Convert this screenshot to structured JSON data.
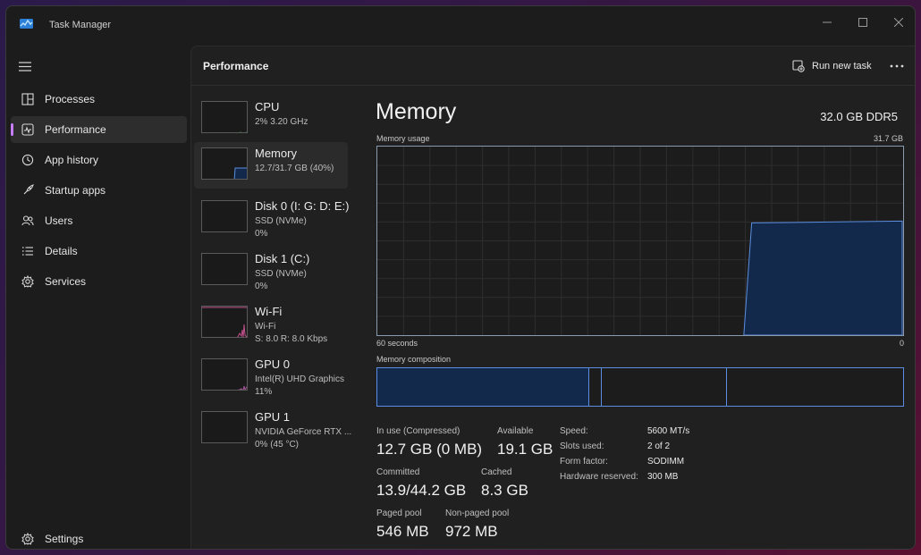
{
  "window": {
    "title": "Task Manager"
  },
  "nav": {
    "items": [
      {
        "label": "Processes",
        "icon": "processes-icon"
      },
      {
        "label": "Performance",
        "icon": "performance-icon",
        "active": true
      },
      {
        "label": "App history",
        "icon": "history-icon"
      },
      {
        "label": "Startup apps",
        "icon": "startup-icon"
      },
      {
        "label": "Users",
        "icon": "users-icon"
      },
      {
        "label": "Details",
        "icon": "details-icon"
      },
      {
        "label": "Services",
        "icon": "services-icon"
      }
    ],
    "settings_label": "Settings"
  },
  "header": {
    "title": "Performance",
    "run_new_task_label": "Run new task"
  },
  "devices": [
    {
      "name": "CPU",
      "line2": "2%  3.20 GHz",
      "line3": ""
    },
    {
      "name": "Memory",
      "line2": "12.7/31.7 GB (40%)",
      "line3": "",
      "active": true
    },
    {
      "name": "Disk 0 (I: G: D: E:)",
      "line2": "SSD (NVMe)",
      "line3": "0%"
    },
    {
      "name": "Disk 1 (C:)",
      "line2": "SSD (NVMe)",
      "line3": "0%"
    },
    {
      "name": "Wi-Fi",
      "line2": "Wi-Fi",
      "line3": "S: 8.0  R: 8.0 Kbps"
    },
    {
      "name": "GPU 0",
      "line2": "Intel(R) UHD Graphics",
      "line3": "11%"
    },
    {
      "name": "GPU 1",
      "line2": "NVIDIA GeForce RTX ...",
      "line3": "0%  (45 °C)"
    }
  ],
  "memory": {
    "title": "Memory",
    "capacity": "32.0 GB DDR5",
    "usage_label": "Memory usage",
    "usage_max": "31.7 GB",
    "time_span": "60 seconds",
    "time_end": "0",
    "composition_label": "Memory composition",
    "usage_fraction": 0.6,
    "stats": {
      "in_use_label": "In use (Compressed)",
      "in_use_value": "12.7 GB (0 MB)",
      "available_label": "Available",
      "available_value": "19.1 GB",
      "committed_label": "Committed",
      "committed_value": "13.9/44.2 GB",
      "cached_label": "Cached",
      "cached_value": "8.3 GB",
      "paged_label": "Paged pool",
      "paged_value": "546 MB",
      "nonpaged_label": "Non-paged pool",
      "nonpaged_value": "972 MB"
    },
    "details": [
      {
        "key": "Speed:",
        "value": "5600 MT/s"
      },
      {
        "key": "Slots used:",
        "value": "2 of 2"
      },
      {
        "key": "Form factor:",
        "value": "SODIMM"
      },
      {
        "key": "Hardware reserved:",
        "value": "300 MB"
      }
    ]
  },
  "colors": {
    "accent": "#c77dff",
    "memory_fill": "#13294b",
    "memory_line": "#5b8ee0",
    "network_line": "#c0508a"
  }
}
